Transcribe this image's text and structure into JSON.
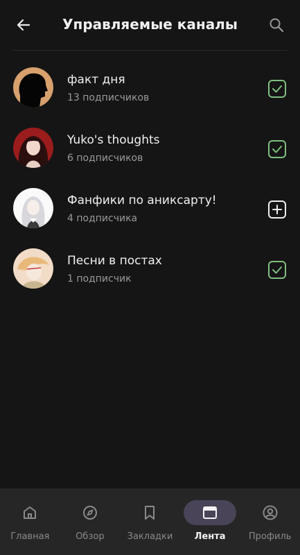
{
  "header": {
    "title": "Управляемые каналы",
    "back_icon": "arrow-left-icon",
    "search_icon": "search-icon"
  },
  "channels": [
    {
      "name": "факт дня",
      "subscribers": "13 подписчиков",
      "status": "checked"
    },
    {
      "name": "Yuko's thoughts",
      "subscribers": "6 подписчиков",
      "status": "checked"
    },
    {
      "name": "Фанфики по аниксарту!",
      "subscribers": "4 подписчика",
      "status": "add"
    },
    {
      "name": "Песни в постах",
      "subscribers": "1 подписчик",
      "status": "checked"
    }
  ],
  "nav": [
    {
      "label": "Главная",
      "icon": "home-icon",
      "active": false
    },
    {
      "label": "Обзор",
      "icon": "compass-icon",
      "active": false
    },
    {
      "label": "Закладки",
      "icon": "bookmark-icon",
      "active": false
    },
    {
      "label": "Лента",
      "icon": "feed-icon",
      "active": true
    },
    {
      "label": "Профиль",
      "icon": "profile-icon",
      "active": false
    }
  ],
  "colors": {
    "background": "#151515",
    "check_accent": "#7fbf7f",
    "nav_background": "#262626",
    "nav_active_pill": "#4a4458"
  }
}
